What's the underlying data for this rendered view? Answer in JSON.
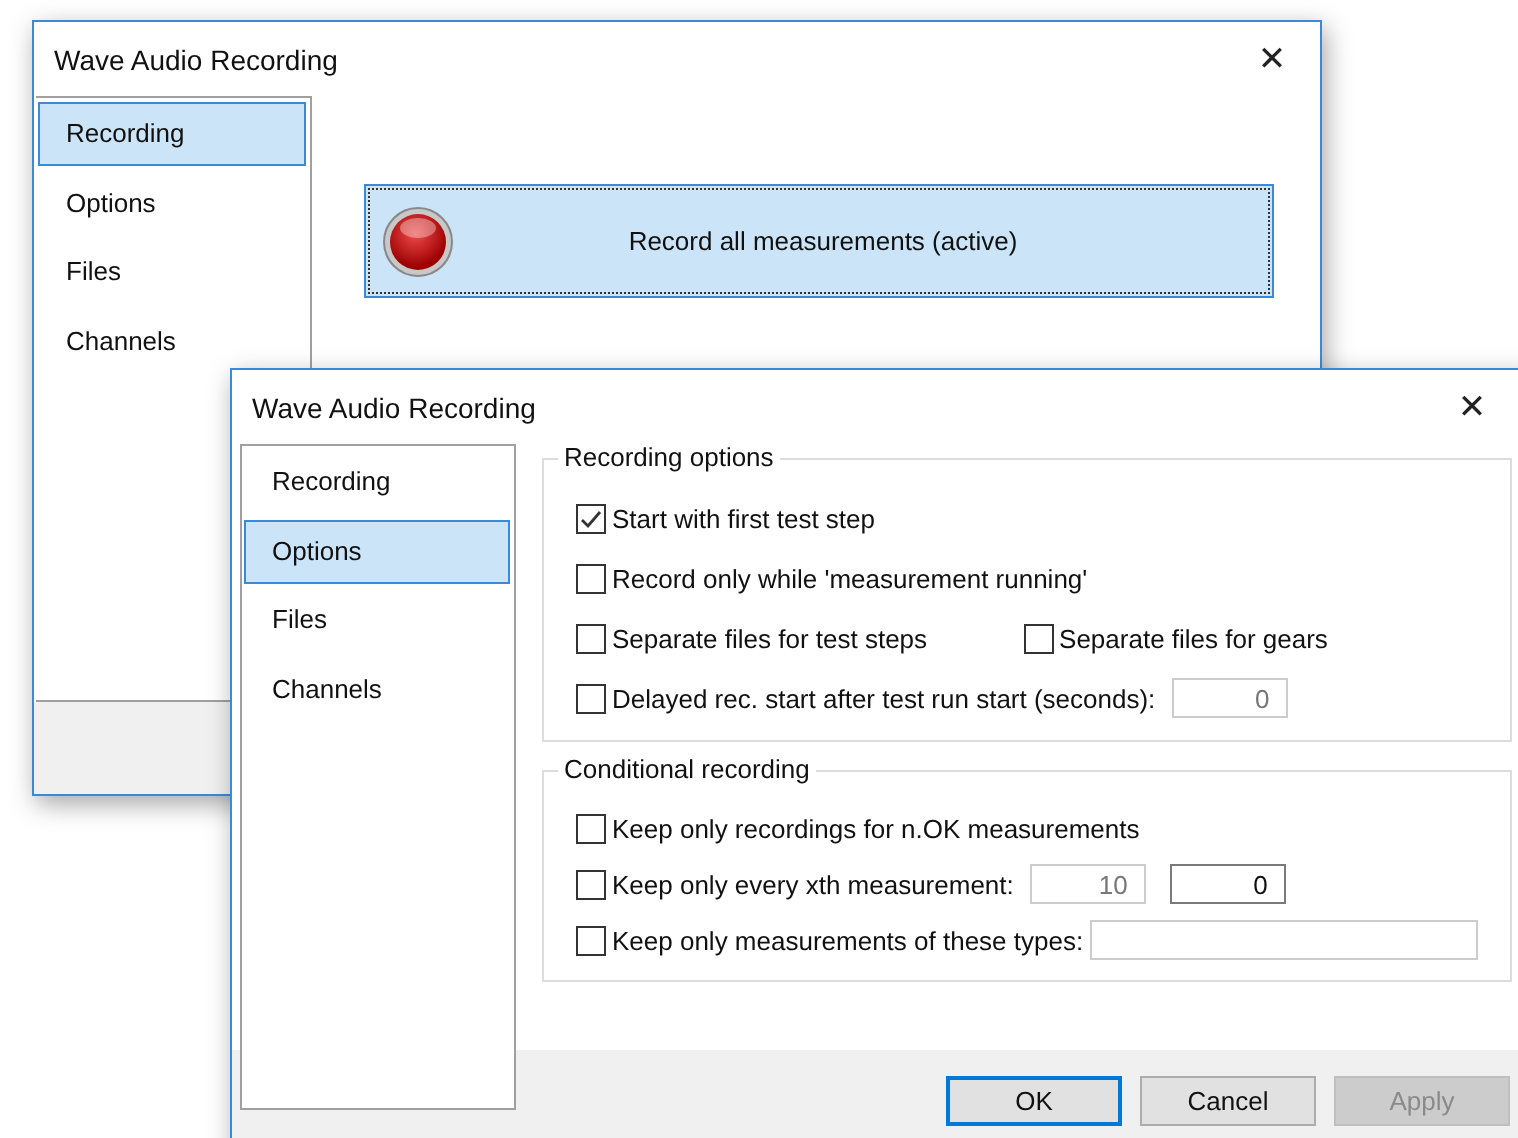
{
  "windows": [
    {
      "title": "Wave Audio Recording",
      "close": "✕",
      "sidebar": [
        {
          "label": "Recording",
          "selected": true
        },
        {
          "label": "Options",
          "selected": false
        },
        {
          "label": "Files",
          "selected": false
        },
        {
          "label": "Channels",
          "selected": false
        }
      ],
      "record_button": {
        "label": "Record all measurements (active)"
      }
    },
    {
      "title": "Wave Audio Recording",
      "close": "✕",
      "sidebar": [
        {
          "label": "Recording",
          "selected": false
        },
        {
          "label": "Options",
          "selected": true
        },
        {
          "label": "Files",
          "selected": false
        },
        {
          "label": "Channels",
          "selected": false
        }
      ],
      "groups": [
        {
          "title": "Recording options",
          "rows": [
            [
              {
                "kind": "checkbox",
                "label": "Start with first test step",
                "checked": true
              }
            ],
            [
              {
                "kind": "checkbox",
                "label": "Record only while 'measurement running'",
                "checked": false
              }
            ],
            [
              {
                "kind": "checkbox",
                "label": "Separate files for test steps",
                "checked": false
              },
              {
                "kind": "checkbox",
                "label": "Separate files for gears",
                "checked": false
              }
            ],
            [
              {
                "kind": "checkbox",
                "label": "Delayed rec. start after test run start (seconds):",
                "checked": false
              },
              {
                "kind": "field",
                "value": "0",
                "disabled": true
              }
            ]
          ]
        },
        {
          "title": "Conditional recording",
          "rows": [
            [
              {
                "kind": "checkbox",
                "label": "Keep only recordings for n.OK measurements",
                "checked": false
              }
            ],
            [
              {
                "kind": "checkbox",
                "label": "Keep only every xth measurement:",
                "checked": false
              },
              {
                "kind": "field",
                "value": "10",
                "disabled": true
              },
              {
                "kind": "field",
                "value": "0",
                "disabled": false
              }
            ],
            [
              {
                "kind": "checkbox",
                "label": "Keep only measurements of these types:",
                "checked": false
              },
              {
                "kind": "widefield"
              }
            ]
          ]
        }
      ],
      "buttons": [
        {
          "label": "OK",
          "default": true,
          "disabled": false
        },
        {
          "label": "Cancel",
          "default": false,
          "disabled": false
        },
        {
          "label": "Apply",
          "default": false,
          "disabled": true
        }
      ]
    }
  ]
}
